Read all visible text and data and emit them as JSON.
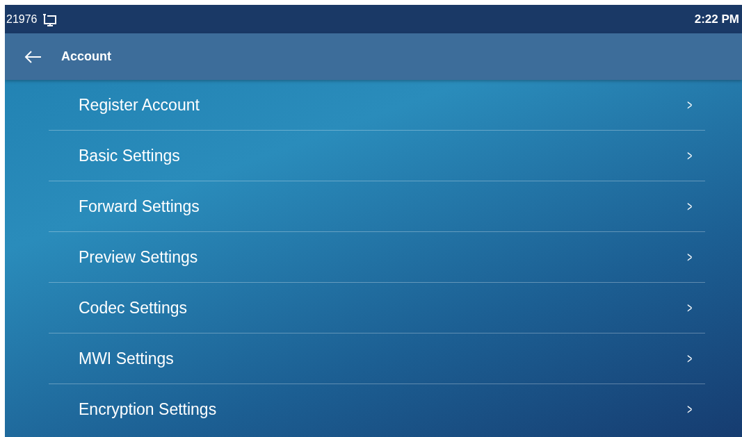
{
  "status_bar": {
    "extension": "21976",
    "time": "2:22 PM"
  },
  "header": {
    "title": "Account"
  },
  "menu_items": [
    {
      "label": "Register Account",
      "chevron": ">"
    },
    {
      "label": "Basic Settings",
      "chevron": ">"
    },
    {
      "label": "Forward Settings",
      "chevron": ">"
    },
    {
      "label": "Preview Settings",
      "chevron": ">"
    },
    {
      "label": "Codec Settings",
      "chevron": ">"
    },
    {
      "label": "MWI Settings",
      "chevron": ">"
    },
    {
      "label": "Encryption Settings",
      "chevron": ">"
    }
  ]
}
